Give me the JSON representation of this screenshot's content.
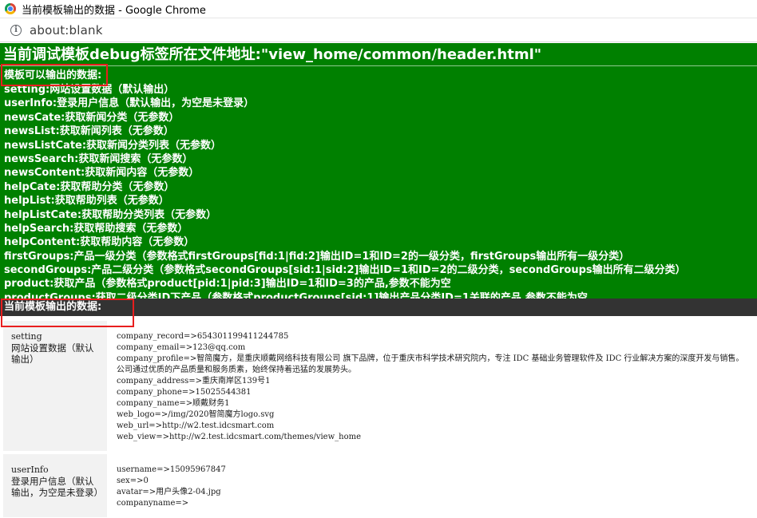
{
  "window": {
    "title": "当前模板输出的数据 - Google Chrome",
    "icon": "chrome-icon"
  },
  "addressbar": {
    "url": "about:blank",
    "icon": "info-icon"
  },
  "debug": {
    "title": "当前调试模板debug标签所在文件地址:\"view_home/common/header.html\"",
    "available_heading": "模板可以输出的数据:",
    "available_items": [
      "setting:网站设置数据（默认输出）",
      "userInfo:登录用户信息（默认输出，为空是未登录）",
      "newsCate:获取新闻分类（无参数）",
      "newsList:获取新闻列表（无参数）",
      "newsListCate:获取新闻分类列表（无参数）",
      "newsSearch:获取新闻搜索（无参数）",
      "newsContent:获取新闻内容（无参数）",
      "helpCate:获取帮助分类（无参数）",
      "helpList:获取帮助列表（无参数）",
      "helpListCate:获取帮助分类列表（无参数）",
      "helpSearch:获取帮助搜索（无参数）",
      "helpContent:获取帮助内容（无参数）",
      "firstGroups:产品一级分类（参数格式firstGroups[fid:1|fid:2]输出ID=1和ID=2的一级分类，firstGroups输出所有一级分类）",
      "secondGroups:产品二级分类（参数格式secondGroups[sid:1|sid:2]输出ID=1和ID=2的二级分类，secondGroups输出所有二级分类）",
      "product:获取产品（参数格式product[pid:1|pid:3]输出ID=1和ID=3的产品,参数不能为空",
      "productGroups:获取二级分类ID下产品（参数格式productGroups[sid:1]输出产品分类ID=1关联的产品,参数不能为空"
    ],
    "current_heading": "当前模板输出的数据:"
  },
  "data_rows": [
    {
      "name": "setting",
      "desc": "网站设置数据（默认输出）",
      "values": [
        "company_record=>654301199411244785",
        "company_email=>123@qq.com",
        "company_profile=>智简魔方，是重庆顺戴网络科技有限公司 旗下品牌，位于重庆市科学技术研究院内，专注 IDC 基础业务管理软件及 IDC 行业解决方案的深度开发与销售。公司通过优质的产品质量和服务质素，始终保持着迅猛的发展势头。",
        "company_address=>重庆南岸区139号1",
        "company_phone=>15025544381",
        "company_name=>顺戴财务1",
        "web_logo=>/img/2020智简魔方logo.svg",
        "web_url=>http://w2.test.idcsmart.com",
        "web_view=>http://w2.test.idcsmart.com/themes/view_home"
      ]
    },
    {
      "name": "userInfo",
      "desc": "登录用户信息（默认输出，为空是未登录）",
      "values": [
        "username=>15095967847",
        "sex=>0",
        "avatar=>用户头像2-04.jpg",
        "companyname=>"
      ]
    }
  ]
}
